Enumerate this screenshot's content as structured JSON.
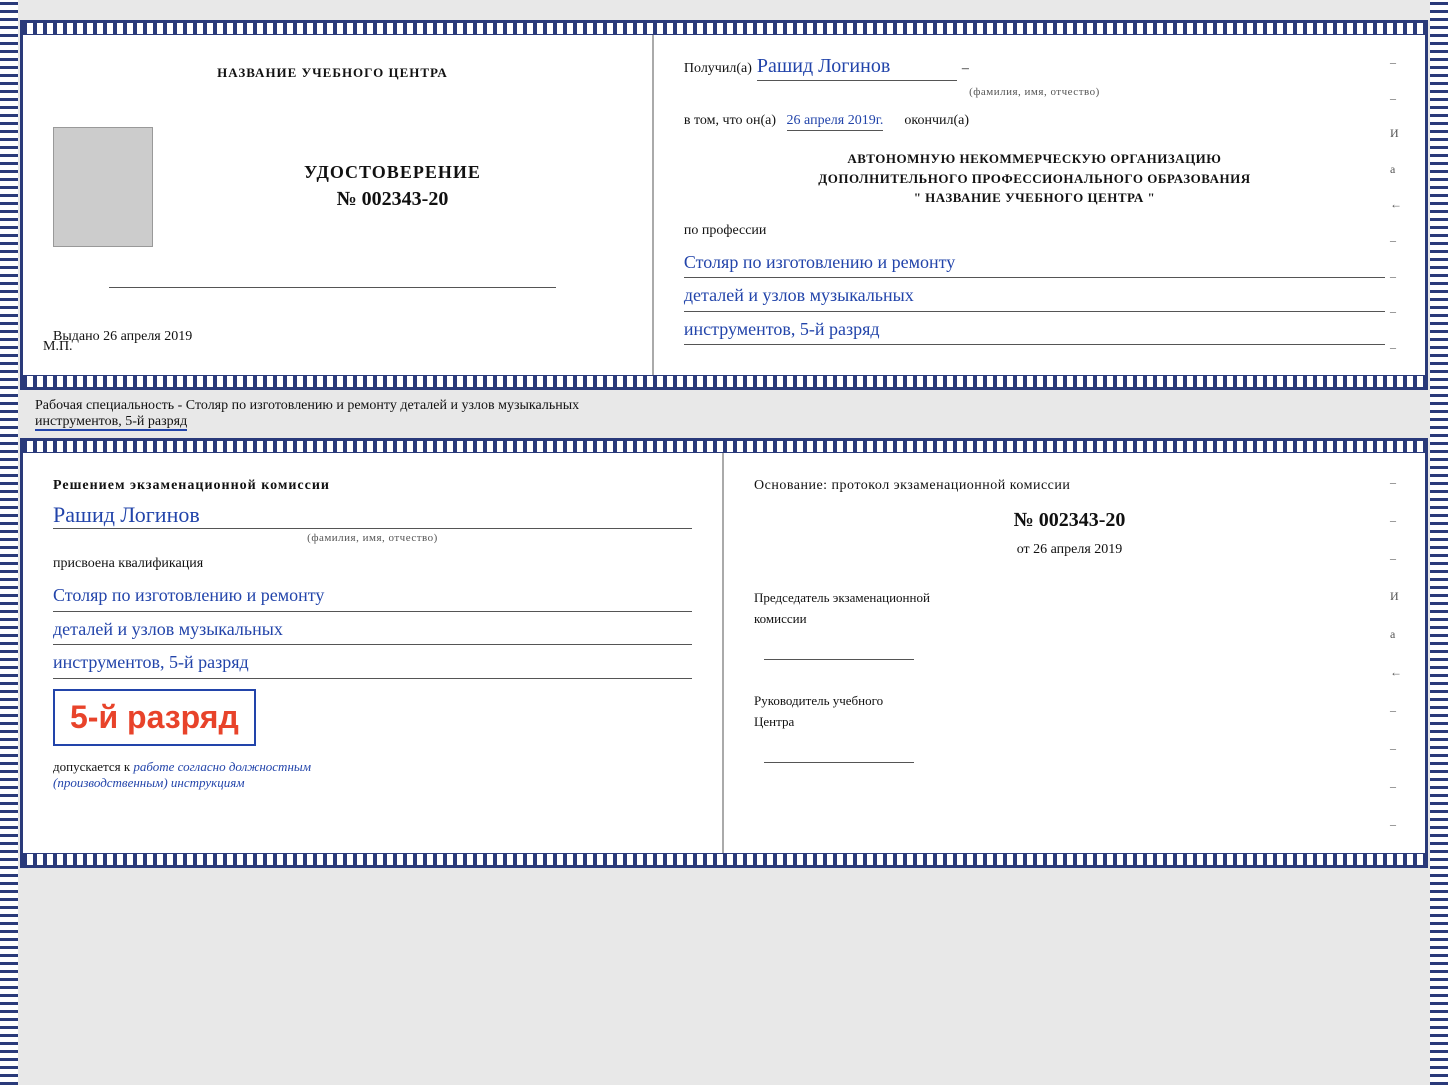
{
  "page": {
    "background": "#e0e0e0"
  },
  "top_cert": {
    "left": {
      "training_center_label": "НАЗВАНИЕ УЧЕБНОГО ЦЕНТРА",
      "cert_title": "УДОСТОВЕРЕНИЕ",
      "cert_number": "№ 002343-20",
      "issued_label": "Выдано",
      "issued_date": "26 апреля 2019",
      "mp_label": "М.П."
    },
    "right": {
      "received_label": "Получил(а)",
      "recipient_name": "Рашид Логинов",
      "name_subtitle": "(фамилия, имя, отчество)",
      "date_line_prefix": "в том, что он(а)",
      "date_handwritten": "26 апреля 2019г.",
      "date_line_suffix": "окончил(а)",
      "org_line1": "АВТОНОМНУЮ НЕКОММЕРЧЕСКУЮ ОРГАНИЗАЦИЮ",
      "org_line2": "ДОПОЛНИТЕЛЬНОГО ПРОФЕССИОНАЛЬНОГО ОБРАЗОВАНИЯ",
      "org_line3": "\"  НАЗВАНИЕ УЧЕБНОГО ЦЕНТРА  \"",
      "profession_label": "по профессии",
      "profession_line1": "Столяр по изготовлению и ремонту",
      "profession_line2": "деталей и узлов музыкальных",
      "profession_line3": "инструментов, 5-й разряд"
    }
  },
  "specialty_text": {
    "full": "Рабочая специальность - Столяр по изготовлению и ремонту деталей и узлов музыкальных",
    "underlined": "инструментов, 5-й разряд"
  },
  "bottom_cert": {
    "left": {
      "commission_text": "Решением экзаменационной комиссии",
      "person_name": "Рашид Логинов",
      "person_subtitle": "(фамилия, имя, отчество)",
      "qualification_label": "присвоена квалификация",
      "qual_line1": "Столяр по изготовлению и ремонту",
      "qual_line2": "деталей и узлов музыкальных",
      "qual_line3": "инструментов, 5-й разряд",
      "rank_text": "5-й разряд",
      "admit_label": "допускается к",
      "admit_handwritten": "работе согласно должностным",
      "admit_handwritten2": "(производственным) инструкциям"
    },
    "right": {
      "basis_label": "Основание: протокол экзаменационной комиссии",
      "protocol_number": "№ 002343-20",
      "protocol_date_prefix": "от",
      "protocol_date": "26 апреля 2019",
      "chairman_label": "Председатель экзаменационной",
      "chairman_label2": "комиссии",
      "director_label": "Руководитель учебного",
      "director_label2": "Центра"
    }
  },
  "dashes": [
    "-",
    "-",
    "-",
    "И",
    "а",
    "←",
    "-",
    "-",
    "-",
    "-"
  ]
}
